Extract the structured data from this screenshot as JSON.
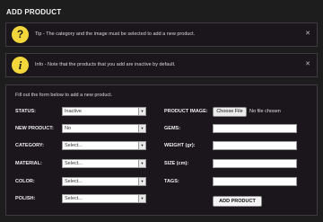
{
  "page": {
    "title": "ADD PRODUCT"
  },
  "notices": [
    {
      "icon": "question-icon",
      "icon_char": "?",
      "text": "Tip - The category and the image must be selected to add a new product.",
      "close": "✕"
    },
    {
      "icon": "info-icon",
      "icon_char": "i",
      "text": "Info - Note that the products that you add are inactive by default.",
      "close": "✕"
    }
  ],
  "form": {
    "intro": "Fill out the form below to add a new product.",
    "left": [
      {
        "label": "STATUS:",
        "value": "Inactive"
      },
      {
        "label": "NEW PRODUCT:",
        "value": "No"
      },
      {
        "label": "CATEGORY:",
        "value": "Select..."
      },
      {
        "label": "MATERIAL:",
        "value": "Select..."
      },
      {
        "label": "COLOR:",
        "value": "Select..."
      },
      {
        "label": "POLISH:",
        "value": "Select..."
      }
    ],
    "right": {
      "product_image_label": "PRODUCT IMAGE:",
      "choose_file": "Choose File",
      "no_file": "No file chosen",
      "gems_label": "GEMS:",
      "weight_label": "WEIGHT (gr):",
      "size_label": "SIZE (cm):",
      "tags_label": "TAGS:"
    },
    "submit": "ADD PRODUCT"
  },
  "colors": {
    "background": "#1d1d1d",
    "panel": "#1a161b",
    "badge": "#f2d63b"
  }
}
